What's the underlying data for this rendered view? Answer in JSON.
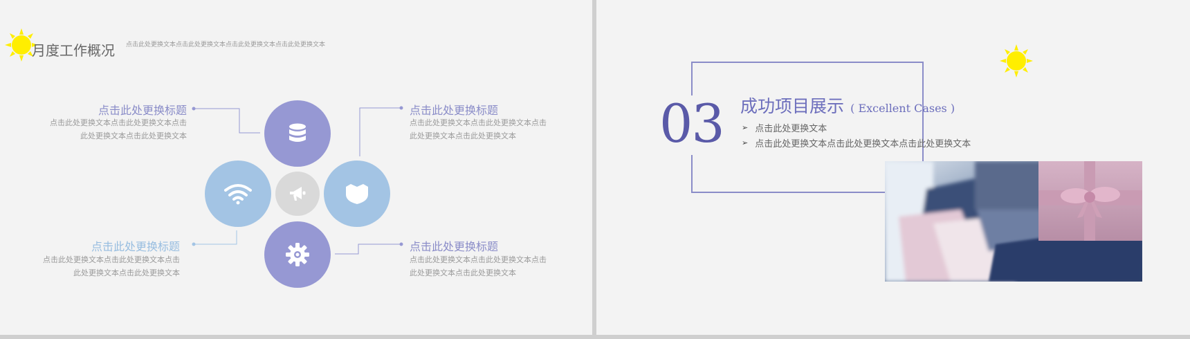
{
  "left_slide": {
    "title": "月度工作概况",
    "subtitle": "点击此处更换文本点击此处更换文本点击此处更换文本点击此处更换文本",
    "items": [
      {
        "title": "点击此处更换标题",
        "line1": "点击此处更换文本点击此处更换文本点击",
        "line2": "此处更换文本点击此处更换文本"
      },
      {
        "title": "点击此处更换标题",
        "line1": "点击此处更换文本点击此处更换文本点击",
        "line2": "此处更换文本点击此处更换文本"
      },
      {
        "title": "点击此处更换标题",
        "line1": "点击此处更换文本点击此处更换文本点击",
        "line2": "此处更换文本点击此处更换文本"
      },
      {
        "title": "点击此处更换标题",
        "line1": "点击此处更换文本点击此处更换文本点击",
        "line2": "此处更换文本点击此处更换文本"
      }
    ],
    "icons": [
      "database-icon",
      "wifi-icon",
      "megaphone-icon",
      "shield-icon",
      "gear-icon"
    ]
  },
  "right_slide": {
    "number": "03",
    "title": "成功项目展示",
    "title_en": "( Excellent Cases )",
    "bullets": [
      "点击此处更换文本",
      "点击此处更换文本点击此处更换文本点击此处更换文本"
    ]
  },
  "colors": {
    "purple": "#9698d3",
    "light_blue": "#a3c4e4",
    "gray_circle": "#d9d9d9",
    "accent_navy": "#5a5aa8",
    "sun": "#ffee00"
  }
}
